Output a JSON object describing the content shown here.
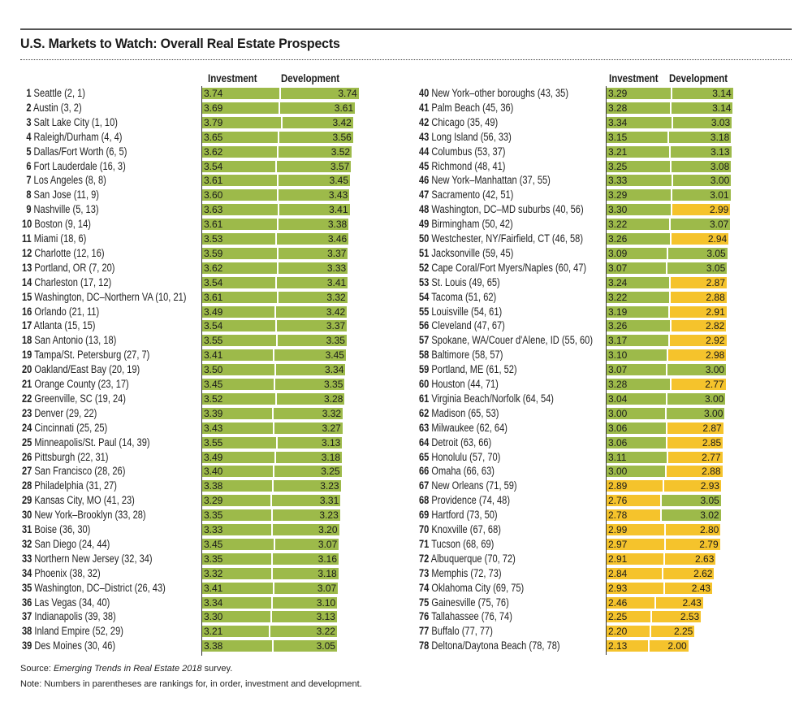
{
  "header": {
    "title": "U.S. Markets to Watch: Overall Real Estate Prospects"
  },
  "colors": {
    "green": "#9dba4a",
    "yellow": "#f5c32c",
    "threshold_note": "values >= 3.00 shown green, below 3.00 shown yellow"
  },
  "columns": {
    "investment": "Investment",
    "development": "Development"
  },
  "footer": {
    "source_prefix": "Source: ",
    "source_title": "Emerging Trends in Real Estate 2018",
    "source_suffix": " survey.",
    "note": "Note: Numbers in parentheses are rankings for, in order, investment and development."
  },
  "chart_data": {
    "type": "bar",
    "orientation": "horizontal-stacked",
    "title": "U.S. Markets to Watch: Overall Real Estate Prospects",
    "series": [
      {
        "name": "Investment"
      },
      {
        "name": "Development"
      }
    ],
    "color_rule": {
      "green": ">= 3.00",
      "yellow": "< 3.00"
    },
    "rows": [
      {
        "rank": 1,
        "market": "Seattle",
        "inv_rank": 2,
        "dev_rank": 1,
        "investment": 3.74,
        "development": 3.74
      },
      {
        "rank": 2,
        "market": "Austin",
        "inv_rank": 3,
        "dev_rank": 2,
        "investment": 3.69,
        "development": 3.61
      },
      {
        "rank": 3,
        "market": "Salt Lake City",
        "inv_rank": 1,
        "dev_rank": 10,
        "investment": 3.79,
        "development": 3.42
      },
      {
        "rank": 4,
        "market": "Raleigh/Durham",
        "inv_rank": 4,
        "dev_rank": 4,
        "investment": 3.65,
        "development": 3.56
      },
      {
        "rank": 5,
        "market": "Dallas/Fort Worth",
        "inv_rank": 6,
        "dev_rank": 5,
        "investment": 3.62,
        "development": 3.52
      },
      {
        "rank": 6,
        "market": "Fort Lauderdale",
        "inv_rank": 16,
        "dev_rank": 3,
        "investment": 3.54,
        "development": 3.57
      },
      {
        "rank": 7,
        "market": "Los Angeles",
        "inv_rank": 8,
        "dev_rank": 8,
        "investment": 3.61,
        "development": 3.45
      },
      {
        "rank": 8,
        "market": "San Jose",
        "inv_rank": 11,
        "dev_rank": 9,
        "investment": 3.6,
        "development": 3.43
      },
      {
        "rank": 9,
        "market": "Nashville",
        "inv_rank": 5,
        "dev_rank": 13,
        "investment": 3.63,
        "development": 3.41
      },
      {
        "rank": 10,
        "market": "Boston",
        "inv_rank": 9,
        "dev_rank": 14,
        "investment": 3.61,
        "development": 3.38
      },
      {
        "rank": 11,
        "market": "Miami",
        "inv_rank": 18,
        "dev_rank": 6,
        "investment": 3.53,
        "development": 3.46
      },
      {
        "rank": 12,
        "market": "Charlotte",
        "inv_rank": 12,
        "dev_rank": 16,
        "investment": 3.59,
        "development": 3.37
      },
      {
        "rank": 13,
        "market": "Portland, OR",
        "inv_rank": 7,
        "dev_rank": 20,
        "investment": 3.62,
        "development": 3.33
      },
      {
        "rank": 14,
        "market": "Charleston",
        "inv_rank": 17,
        "dev_rank": 12,
        "investment": 3.54,
        "development": 3.41
      },
      {
        "rank": 15,
        "market": "Washington, DC–Northern VA",
        "inv_rank": 10,
        "dev_rank": 21,
        "investment": 3.61,
        "development": 3.32
      },
      {
        "rank": 16,
        "market": "Orlando",
        "inv_rank": 21,
        "dev_rank": 11,
        "investment": 3.49,
        "development": 3.42
      },
      {
        "rank": 17,
        "market": "Atlanta",
        "inv_rank": 15,
        "dev_rank": 15,
        "investment": 3.54,
        "development": 3.37
      },
      {
        "rank": 18,
        "market": "San Antonio",
        "inv_rank": 13,
        "dev_rank": 18,
        "investment": 3.55,
        "development": 3.35
      },
      {
        "rank": 19,
        "market": "Tampa/St. Petersburg",
        "inv_rank": 27,
        "dev_rank": 7,
        "investment": 3.41,
        "development": 3.45
      },
      {
        "rank": 20,
        "market": "Oakland/East Bay",
        "inv_rank": 20,
        "dev_rank": 19,
        "investment": 3.5,
        "development": 3.34
      },
      {
        "rank": 21,
        "market": "Orange County",
        "inv_rank": 23,
        "dev_rank": 17,
        "investment": 3.45,
        "development": 3.35
      },
      {
        "rank": 22,
        "market": "Greenville, SC",
        "inv_rank": 19,
        "dev_rank": 24,
        "investment": 3.52,
        "development": 3.28
      },
      {
        "rank": 23,
        "market": "Denver",
        "inv_rank": 29,
        "dev_rank": 22,
        "investment": 3.39,
        "development": 3.32
      },
      {
        "rank": 24,
        "market": "Cincinnati",
        "inv_rank": 25,
        "dev_rank": 25,
        "investment": 3.43,
        "development": 3.27
      },
      {
        "rank": 25,
        "market": "Minneapolis/St. Paul",
        "inv_rank": 14,
        "dev_rank": 39,
        "investment": 3.55,
        "development": 3.13
      },
      {
        "rank": 26,
        "market": "Pittsburgh",
        "inv_rank": 22,
        "dev_rank": 31,
        "investment": 3.49,
        "development": 3.18
      },
      {
        "rank": 27,
        "market": "San Francisco",
        "inv_rank": 28,
        "dev_rank": 26,
        "investment": 3.4,
        "development": 3.25
      },
      {
        "rank": 28,
        "market": "Philadelphia",
        "inv_rank": 31,
        "dev_rank": 27,
        "investment": 3.38,
        "development": 3.23
      },
      {
        "rank": 29,
        "market": "Kansas City, MO",
        "inv_rank": 41,
        "dev_rank": 23,
        "investment": 3.29,
        "development": 3.31
      },
      {
        "rank": 30,
        "market": "New York–Brooklyn",
        "inv_rank": 33,
        "dev_rank": 28,
        "investment": 3.35,
        "development": 3.23
      },
      {
        "rank": 31,
        "market": "Boise",
        "inv_rank": 36,
        "dev_rank": 30,
        "investment": 3.33,
        "development": 3.2
      },
      {
        "rank": 32,
        "market": "San Diego",
        "inv_rank": 24,
        "dev_rank": 44,
        "investment": 3.45,
        "development": 3.07
      },
      {
        "rank": 33,
        "market": "Northern New Jersey",
        "inv_rank": 32,
        "dev_rank": 34,
        "investment": 3.35,
        "development": 3.16
      },
      {
        "rank": 34,
        "market": "Phoenix",
        "inv_rank": 38,
        "dev_rank": 32,
        "investment": 3.32,
        "development": 3.18
      },
      {
        "rank": 35,
        "market": "Washington, DC–District",
        "inv_rank": 26,
        "dev_rank": 43,
        "investment": 3.41,
        "development": 3.07
      },
      {
        "rank": 36,
        "market": "Las Vegas",
        "inv_rank": 34,
        "dev_rank": 40,
        "investment": 3.34,
        "development": 3.1
      },
      {
        "rank": 37,
        "market": "Indianapolis",
        "inv_rank": 39,
        "dev_rank": 38,
        "investment": 3.3,
        "development": 3.13
      },
      {
        "rank": 38,
        "market": "Inland Empire",
        "inv_rank": 52,
        "dev_rank": 29,
        "investment": 3.21,
        "development": 3.22
      },
      {
        "rank": 39,
        "market": "Des Moines",
        "inv_rank": 30,
        "dev_rank": 46,
        "investment": 3.38,
        "development": 3.05
      },
      {
        "rank": 40,
        "market": "New York–other boroughs",
        "inv_rank": 43,
        "dev_rank": 35,
        "investment": 3.29,
        "development": 3.14
      },
      {
        "rank": 41,
        "market": "Palm Beach",
        "inv_rank": 45,
        "dev_rank": 36,
        "investment": 3.28,
        "development": 3.14
      },
      {
        "rank": 42,
        "market": "Chicago",
        "inv_rank": 35,
        "dev_rank": 49,
        "investment": 3.34,
        "development": 3.03
      },
      {
        "rank": 43,
        "market": "Long Island",
        "inv_rank": 56,
        "dev_rank": 33,
        "investment": 3.15,
        "development": 3.18
      },
      {
        "rank": 44,
        "market": "Columbus",
        "inv_rank": 53,
        "dev_rank": 37,
        "investment": 3.21,
        "development": 3.13
      },
      {
        "rank": 45,
        "market": "Richmond",
        "inv_rank": 48,
        "dev_rank": 41,
        "investment": 3.25,
        "development": 3.08
      },
      {
        "rank": 46,
        "market": "New York–Manhattan",
        "inv_rank": 37,
        "dev_rank": 55,
        "investment": 3.33,
        "development": 3.0
      },
      {
        "rank": 47,
        "market": "Sacramento",
        "inv_rank": 42,
        "dev_rank": 51,
        "investment": 3.29,
        "development": 3.01
      },
      {
        "rank": 48,
        "market": "Washington, DC–MD suburbs",
        "inv_rank": 40,
        "dev_rank": 56,
        "investment": 3.3,
        "development": 2.99
      },
      {
        "rank": 49,
        "market": "Birmingham",
        "inv_rank": 50,
        "dev_rank": 42,
        "investment": 3.22,
        "development": 3.07
      },
      {
        "rank": 50,
        "market": "Westchester, NY/Fairfield, CT",
        "inv_rank": 46,
        "dev_rank": 58,
        "investment": 3.26,
        "development": 2.94
      },
      {
        "rank": 51,
        "market": "Jacksonville",
        "inv_rank": 59,
        "dev_rank": 45,
        "investment": 3.09,
        "development": 3.05
      },
      {
        "rank": 52,
        "market": "Cape Coral/Fort Myers/Naples",
        "inv_rank": 60,
        "dev_rank": 47,
        "investment": 3.07,
        "development": 3.05
      },
      {
        "rank": 53,
        "market": "St. Louis",
        "inv_rank": 49,
        "dev_rank": 65,
        "investment": 3.24,
        "development": 2.87
      },
      {
        "rank": 54,
        "market": "Tacoma",
        "inv_rank": 51,
        "dev_rank": 62,
        "investment": 3.22,
        "development": 2.88
      },
      {
        "rank": 55,
        "market": "Louisville",
        "inv_rank": 54,
        "dev_rank": 61,
        "investment": 3.19,
        "development": 2.91
      },
      {
        "rank": 56,
        "market": "Cleveland",
        "inv_rank": 47,
        "dev_rank": 67,
        "investment": 3.26,
        "development": 2.82
      },
      {
        "rank": 57,
        "market": "Spokane, WA/Couer d'Alene, ID",
        "inv_rank": 55,
        "dev_rank": 60,
        "investment": 3.17,
        "development": 2.92
      },
      {
        "rank": 58,
        "market": "Baltimore",
        "inv_rank": 58,
        "dev_rank": 57,
        "investment": 3.1,
        "development": 2.98
      },
      {
        "rank": 59,
        "market": "Portland, ME",
        "inv_rank": 61,
        "dev_rank": 52,
        "investment": 3.07,
        "development": 3.0
      },
      {
        "rank": 60,
        "market": "Houston",
        "inv_rank": 44,
        "dev_rank": 71,
        "investment": 3.28,
        "development": 2.77
      },
      {
        "rank": 61,
        "market": "Virginia Beach/Norfolk",
        "inv_rank": 64,
        "dev_rank": 54,
        "investment": 3.04,
        "development": 3.0
      },
      {
        "rank": 62,
        "market": "Madison",
        "inv_rank": 65,
        "dev_rank": 53,
        "investment": 3.0,
        "development": 3.0
      },
      {
        "rank": 63,
        "market": "Milwaukee",
        "inv_rank": 62,
        "dev_rank": 64,
        "investment": 3.06,
        "development": 2.87
      },
      {
        "rank": 64,
        "market": "Detroit",
        "inv_rank": 63,
        "dev_rank": 66,
        "investment": 3.06,
        "development": 2.85
      },
      {
        "rank": 65,
        "market": "Honolulu",
        "inv_rank": 57,
        "dev_rank": 70,
        "investment": 3.11,
        "development": 2.77
      },
      {
        "rank": 66,
        "market": "Omaha",
        "inv_rank": 66,
        "dev_rank": 63,
        "investment": 3.0,
        "development": 2.88
      },
      {
        "rank": 67,
        "market": "New Orleans",
        "inv_rank": 71,
        "dev_rank": 59,
        "investment": 2.89,
        "development": 2.93
      },
      {
        "rank": 68,
        "market": "Providence",
        "inv_rank": 74,
        "dev_rank": 48,
        "investment": 2.76,
        "development": 3.05
      },
      {
        "rank": 69,
        "market": "Hartford",
        "inv_rank": 73,
        "dev_rank": 50,
        "investment": 2.78,
        "development": 3.02
      },
      {
        "rank": 70,
        "market": "Knoxville",
        "inv_rank": 67,
        "dev_rank": 68,
        "investment": 2.99,
        "development": 2.8
      },
      {
        "rank": 71,
        "market": "Tucson",
        "inv_rank": 68,
        "dev_rank": 69,
        "investment": 2.97,
        "development": 2.79
      },
      {
        "rank": 72,
        "market": "Albuquerque",
        "inv_rank": 70,
        "dev_rank": 72,
        "investment": 2.91,
        "development": 2.63
      },
      {
        "rank": 73,
        "market": "Memphis",
        "inv_rank": 72,
        "dev_rank": 73,
        "investment": 2.84,
        "development": 2.62
      },
      {
        "rank": 74,
        "market": "Oklahoma City",
        "inv_rank": 69,
        "dev_rank": 75,
        "investment": 2.93,
        "development": 2.43
      },
      {
        "rank": 75,
        "market": "Gainesville",
        "inv_rank": 75,
        "dev_rank": 76,
        "investment": 2.46,
        "development": 2.43
      },
      {
        "rank": 76,
        "market": "Tallahassee",
        "inv_rank": 76,
        "dev_rank": 74,
        "investment": 2.25,
        "development": 2.53
      },
      {
        "rank": 77,
        "market": "Buffalo",
        "inv_rank": 77,
        "dev_rank": 77,
        "investment": 2.2,
        "development": 2.25
      },
      {
        "rank": 78,
        "market": "Deltona/Daytona Beach",
        "inv_rank": 78,
        "dev_rank": 78,
        "investment": 2.13,
        "development": 2.0
      }
    ]
  }
}
